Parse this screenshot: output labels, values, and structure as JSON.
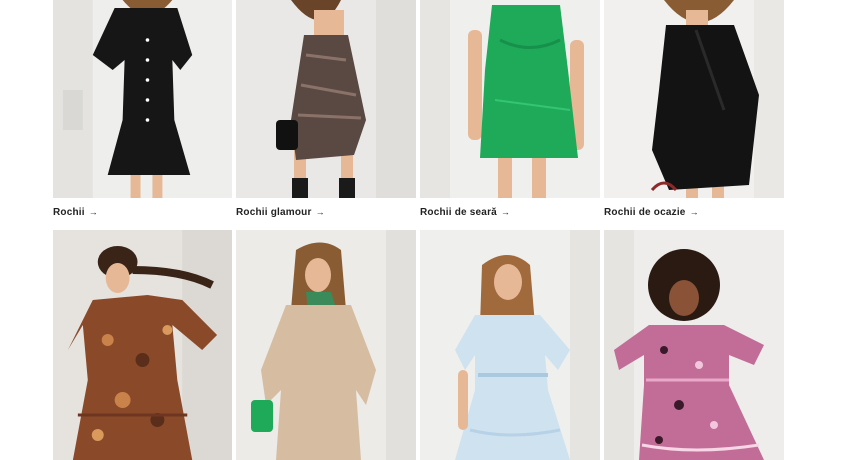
{
  "categories_top": [
    {
      "label": "Rochii",
      "image": "black-button-dress-photo",
      "bg": "#eeeeec",
      "dress": "#161616"
    },
    {
      "label": "Rochii glamour",
      "image": "sequin-slip-dress-photo",
      "bg": "#e9e8e6",
      "dress": "#5a4842"
    },
    {
      "label": "Rochii de seară",
      "image": "green-satin-dress-photo",
      "bg": "#efefed",
      "dress": "#1faa5a"
    },
    {
      "label": "Rochii de ocazie",
      "image": "black-wrap-dress-photo",
      "bg": "#f1f0ee",
      "dress": "#131313"
    }
  ],
  "categories_bottom": [
    {
      "image": "paisley-print-dress-photo",
      "bg": "#e6e3df",
      "dress": "#8a4a2a"
    },
    {
      "image": "beige-knit-dress-photo",
      "bg": "#ecebe8",
      "dress": "#d6bda2"
    },
    {
      "image": "light-blue-ruffle-dress-photo",
      "bg": "#efefed",
      "dress": "#cfe2f0"
    },
    {
      "image": "floral-pink-dress-photo",
      "bg": "#eeedeb",
      "dress": "#c26d98"
    }
  ],
  "arrow_glyph": "→",
  "colors": {
    "skin": "#e7b896",
    "hair_dark": "#3a2418",
    "hair_light": "#8a5c34",
    "text": "#222222"
  }
}
